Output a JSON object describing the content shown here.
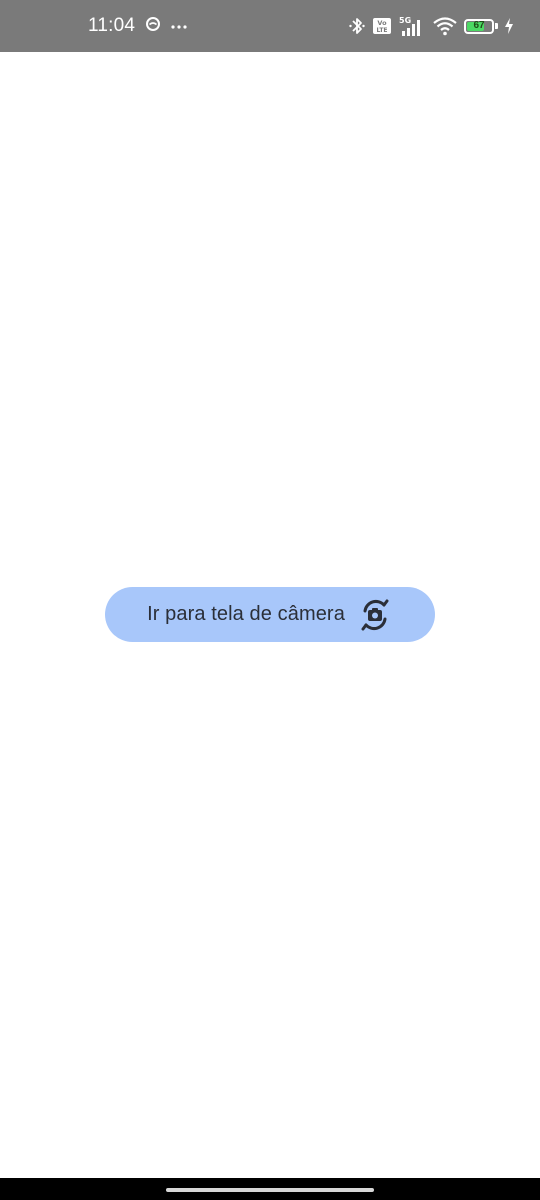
{
  "status_bar": {
    "time": "11:04",
    "more_indicator": "···",
    "network_type": "5G",
    "volte_label_top": "Vo",
    "volte_label_bottom": "LTE",
    "battery_level": "67",
    "battery_fraction": 0.67,
    "icons": [
      "notification-app-icon",
      "more-icon",
      "bluetooth-icon",
      "volte-icon",
      "cell-signal-icon",
      "wifi-icon",
      "battery-icon",
      "charging-icon"
    ],
    "colors": {
      "background": "#7a7a7a",
      "battery_fill": "#4cd964"
    }
  },
  "main": {
    "camera_button": {
      "label": "Ir para tela de câmera",
      "icon": "switch-camera-icon",
      "background": "#a8c7fa"
    }
  },
  "nav_bar": {
    "background": "#000000"
  }
}
